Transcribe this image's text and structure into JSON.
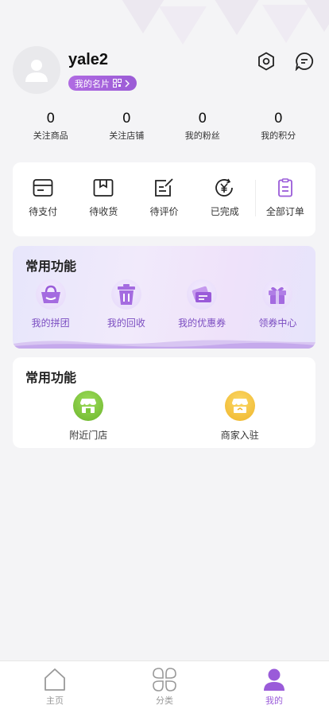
{
  "profile": {
    "username": "yale2",
    "card_label": "我的名片",
    "card_qr_icon": "qr-code-icon",
    "settings_icon": "settings-hexagon-icon",
    "message_icon": "message-bubble-icon"
  },
  "stats": [
    {
      "value": "0",
      "label": "关注商品"
    },
    {
      "value": "0",
      "label": "关注店铺"
    },
    {
      "value": "0",
      "label": "我的粉丝"
    },
    {
      "value": "0",
      "label": "我的积分"
    }
  ],
  "orders": [
    {
      "label": "待支付",
      "icon": "wallet-icon"
    },
    {
      "label": "待收货",
      "icon": "package-icon"
    },
    {
      "label": "待评价",
      "icon": "edit-review-icon"
    },
    {
      "label": "已完成",
      "icon": "yen-refresh-icon"
    },
    {
      "label": "全部订单",
      "icon": "clipboard-icon"
    }
  ],
  "common1": {
    "title": "常用功能",
    "items": [
      {
        "label": "我的拼团",
        "icon": "basket-icon"
      },
      {
        "label": "我的回收",
        "icon": "trash-icon"
      },
      {
        "label": "我的优惠券",
        "icon": "coupons-icon"
      },
      {
        "label": "领券中心",
        "icon": "gift-icon"
      }
    ]
  },
  "common2": {
    "title": "常用功能",
    "items": [
      {
        "label": "附近门店",
        "icon": "store-icon",
        "color": "#7cc63a"
      },
      {
        "label": "商家入驻",
        "icon": "merchant-icon",
        "color": "#f5c542"
      }
    ]
  },
  "tabbar": [
    {
      "label": "主页",
      "icon": "home-icon",
      "active": false
    },
    {
      "label": "分类",
      "icon": "category-icon",
      "active": false
    },
    {
      "label": "我的",
      "icon": "user-icon",
      "active": true
    }
  ],
  "colors": {
    "accent": "#9a5bd9",
    "background": "#f4f4f6"
  }
}
